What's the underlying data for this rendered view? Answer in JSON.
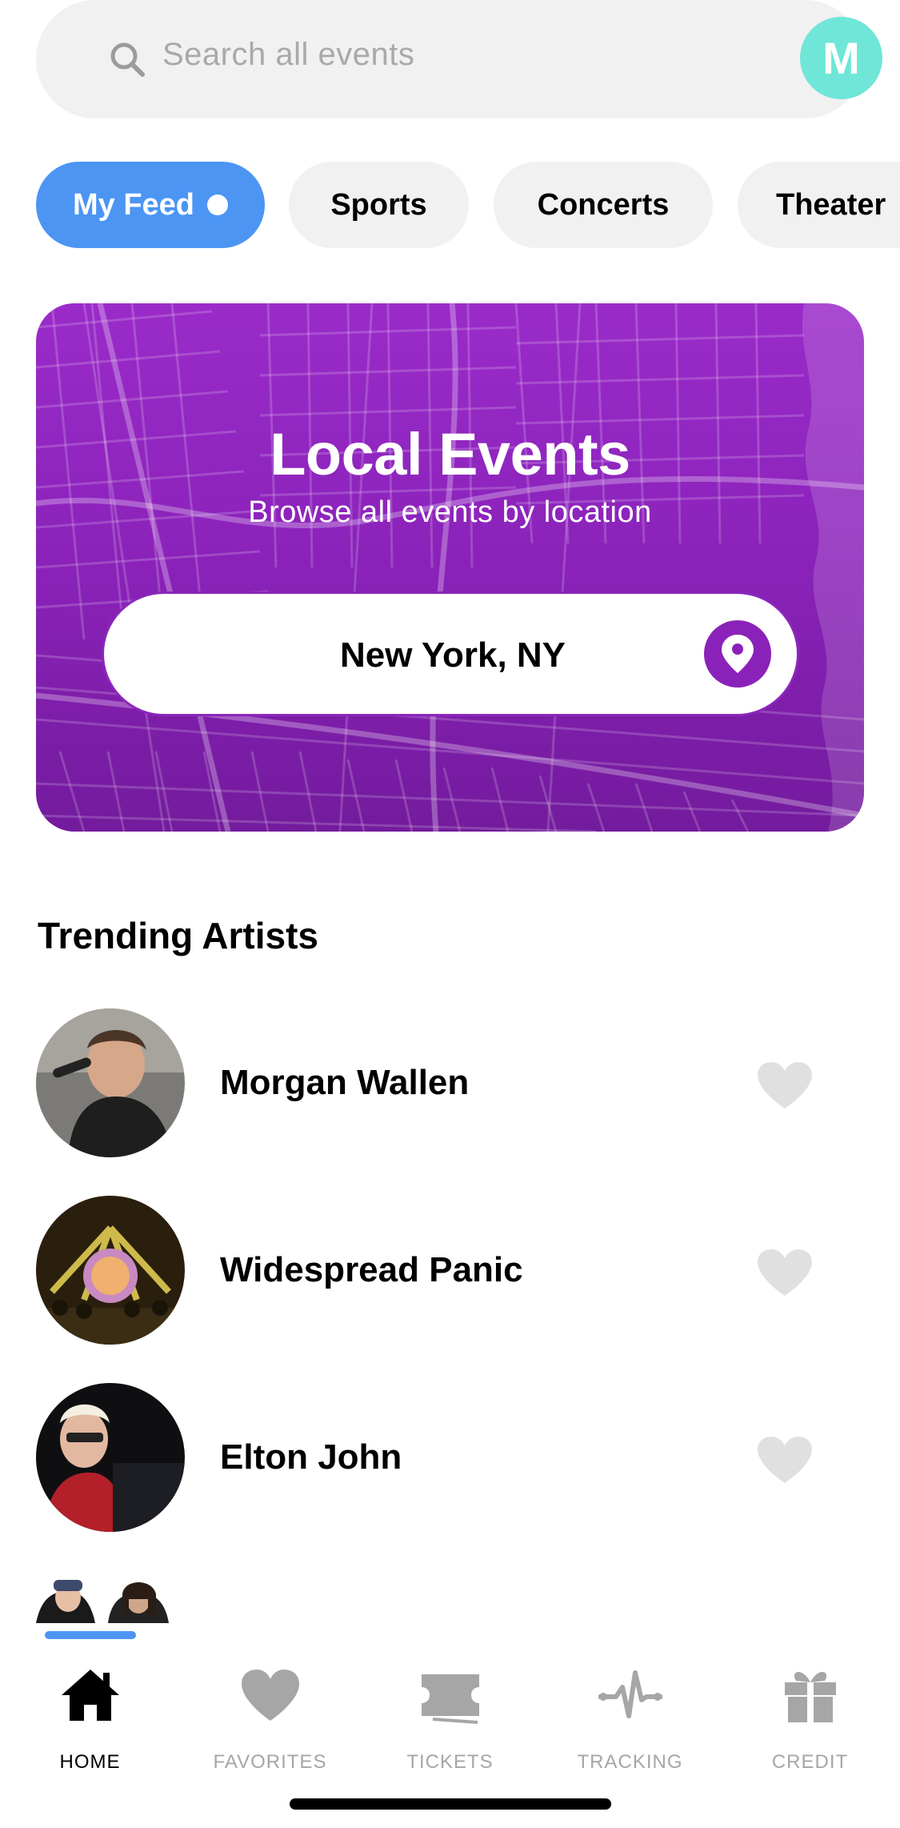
{
  "search": {
    "placeholder": "Search all events",
    "avatar_initial": "M",
    "avatar_color": "#6fe6d8"
  },
  "chips": [
    {
      "label": "My Feed",
      "active": true
    },
    {
      "label": "Sports",
      "active": false
    },
    {
      "label": "Concerts",
      "active": false
    },
    {
      "label": "Theater",
      "active": false
    }
  ],
  "local_events": {
    "title": "Local Events",
    "subtitle": "Browse all events by location",
    "location": "New York, NY",
    "accent_color": "#8a22b9"
  },
  "trending": {
    "title": "Trending Artists",
    "artists": [
      {
        "name": "Morgan Wallen",
        "favorited": false
      },
      {
        "name": "Widespread Panic",
        "favorited": false
      },
      {
        "name": "Elton John",
        "favorited": false
      }
    ]
  },
  "nav": {
    "items": [
      {
        "label": "HOME",
        "icon": "home-icon",
        "active": true
      },
      {
        "label": "FAVORITES",
        "icon": "heart-icon",
        "active": false
      },
      {
        "label": "TICKETS",
        "icon": "ticket-icon",
        "active": false
      },
      {
        "label": "TRACKING",
        "icon": "pulse-icon",
        "active": false
      },
      {
        "label": "CREDIT",
        "icon": "gift-icon",
        "active": false
      }
    ]
  },
  "colors": {
    "primary_blue": "#4c95f3",
    "purple": "#8a22b9",
    "inactive_gray": "#a6a6a6",
    "heart_gray": "#e0e0e0"
  }
}
